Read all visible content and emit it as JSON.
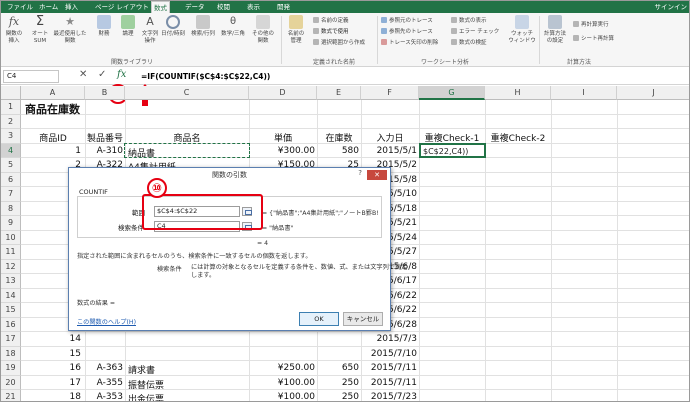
{
  "ribbon": {
    "tabs": [
      "ファイル",
      "ホーム",
      "挿入",
      "ページ レイアウト",
      "数式",
      "データ",
      "校閲",
      "表示",
      "開発"
    ],
    "active_tab": "数式",
    "signin": "サインイン",
    "buttons": {
      "insert_function": "関数の\n挿入",
      "autosum": "オート\nSUM",
      "recent": "最近使用した\n関数",
      "financial": "財務",
      "logical": "論理",
      "text": "文字列\n操作",
      "datetime": "日付/時刻",
      "lookup": "検索/行列",
      "math": "数学/三角",
      "more": "その他の\n関数",
      "name_manager": "名前の\n管理",
      "define_name": "名前の定義",
      "use_in_formula": "数式で使用",
      "create_from_selection": "選択範囲から作成",
      "trace_precedents": "参照元のトレース",
      "trace_dependents": "参照先のトレース",
      "remove_arrows": "トレース矢印の削除",
      "show_formulas": "数式の表示",
      "error_check": "エラー チェック",
      "evaluate": "数式の検証",
      "watch": "ウォッチ\nウィンドウ",
      "calc_options": "計算方法\nの設定",
      "calc_now": "再計算実行",
      "calc_sheet": "シート再計算"
    },
    "groups": {
      "function_library": "関数ライブラリ",
      "defined_names": "定義された名前",
      "formula_auditing": "ワークシート分析",
      "calculation": "計算方法"
    }
  },
  "formula_bar": {
    "name_box": "C4",
    "cancel": "✕",
    "enter": "✓",
    "fx": "fx",
    "formula": "=IF(COUNTIF($C$4:$C$22,C4))"
  },
  "badges": {
    "step11": "⑪",
    "step10": "⑩"
  },
  "sheet": {
    "columns": [
      "A",
      "B",
      "C",
      "D",
      "E",
      "F",
      "G",
      "H",
      "I",
      "J"
    ],
    "selected_column": "G",
    "rows": [
      "1",
      "2",
      "3",
      "4",
      "5",
      "6",
      "7",
      "8",
      "9",
      "10",
      "11",
      "12",
      "13",
      "14",
      "15",
      "16",
      "17",
      "18",
      "19",
      "20",
      "21",
      "22"
    ],
    "selected_row": "4",
    "title": "商品在庫数",
    "headers": [
      "商品ID",
      "製品番号",
      "商品名",
      "単価",
      "在庫数",
      "入力日",
      "重複Check-1",
      "重複Check-2"
    ],
    "data_rows": [
      {
        "id": "1",
        "code": "A-310",
        "name": "納品書",
        "price": "¥300.00",
        "stock": "580",
        "date": "2015/5/1"
      },
      {
        "id": "2",
        "code": "A-322",
        "name": "A4集計用紙",
        "price": "¥150.00",
        "stock": "25",
        "date": "2015/5/2"
      },
      {
        "id": "3",
        "code": "",
        "name": "",
        "price": "",
        "stock": "",
        "date": "2015/5/8"
      },
      {
        "id": "4",
        "code": "",
        "name": "",
        "price": "",
        "stock": "",
        "date": "2015/5/10"
      },
      {
        "id": "5",
        "code": "",
        "name": "",
        "price": "",
        "stock": "",
        "date": "2015/5/18"
      },
      {
        "id": "6",
        "code": "",
        "name": "",
        "price": "",
        "stock": "",
        "date": "2015/5/21"
      },
      {
        "id": "7",
        "code": "",
        "name": "",
        "price": "",
        "stock": "",
        "date": "2015/5/24"
      },
      {
        "id": "8",
        "code": "",
        "name": "",
        "price": "",
        "stock": "",
        "date": "2015/5/27"
      },
      {
        "id": "9",
        "code": "",
        "name": "",
        "price": "",
        "stock": "",
        "date": "2015/6/8"
      },
      {
        "id": "10",
        "code": "",
        "name": "",
        "price": "",
        "stock": "",
        "date": "2015/6/17"
      },
      {
        "id": "11",
        "code": "",
        "name": "",
        "price": "",
        "stock": "",
        "date": "2015/6/22"
      },
      {
        "id": "12",
        "code": "",
        "name": "",
        "price": "",
        "stock": "",
        "date": "2015/6/22"
      },
      {
        "id": "13",
        "code": "",
        "name": "",
        "price": "",
        "stock": "",
        "date": "2015/6/28"
      },
      {
        "id": "14",
        "code": "",
        "name": "",
        "price": "",
        "stock": "",
        "date": "2015/7/3"
      },
      {
        "id": "15",
        "code": "",
        "name": "",
        "price": "",
        "stock": "",
        "date": "2015/7/10"
      },
      {
        "id": "16",
        "code": "A-363",
        "name": "請求書",
        "price": "¥250.00",
        "stock": "650",
        "date": "2015/7/11"
      },
      {
        "id": "17",
        "code": "A-355",
        "name": "振替伝票",
        "price": "¥100.00",
        "stock": "250",
        "date": "2015/7/11"
      },
      {
        "id": "18",
        "code": "A-353",
        "name": "出金伝票",
        "price": "¥100.00",
        "stock": "250",
        "date": "2015/7/23"
      },
      {
        "id": "19",
        "code": "A-365",
        "name": "納品書",
        "price": "¥200.00",
        "stock": "500",
        "date": "2015/7/23"
      }
    ],
    "active_cell_text": "$C$22,C4))"
  },
  "dialog": {
    "title": "関数の引数",
    "help_q": "?",
    "close": "✕",
    "function_name": "COUNTIF",
    "arg1_label": "範囲",
    "arg1_value": "$C$4:$C$22",
    "arg1_result": "= {\"納品書\";\"A4集計用紙\";\"ノートB罫B!",
    "arg2_label": "検索条件",
    "arg2_value": "C4",
    "arg2_result": "= \"納品書\"",
    "overall_result": "= 4",
    "description": "指定された範囲に含まれるセルのうち、検索条件に一致するセルの個数を返します。",
    "arg_help_label": "検索条件",
    "arg_help_text": "には計算の対象となるセルを定義する条件を、数値、式、または文字列で指定\nします。",
    "result_label": "数式の結果 =",
    "help_link": "この関数のヘルプ(H)",
    "ok": "OK",
    "cancel": "キャンセル"
  },
  "colors": {
    "excel_green": "#217346",
    "annotation_red": "#e60012"
  }
}
